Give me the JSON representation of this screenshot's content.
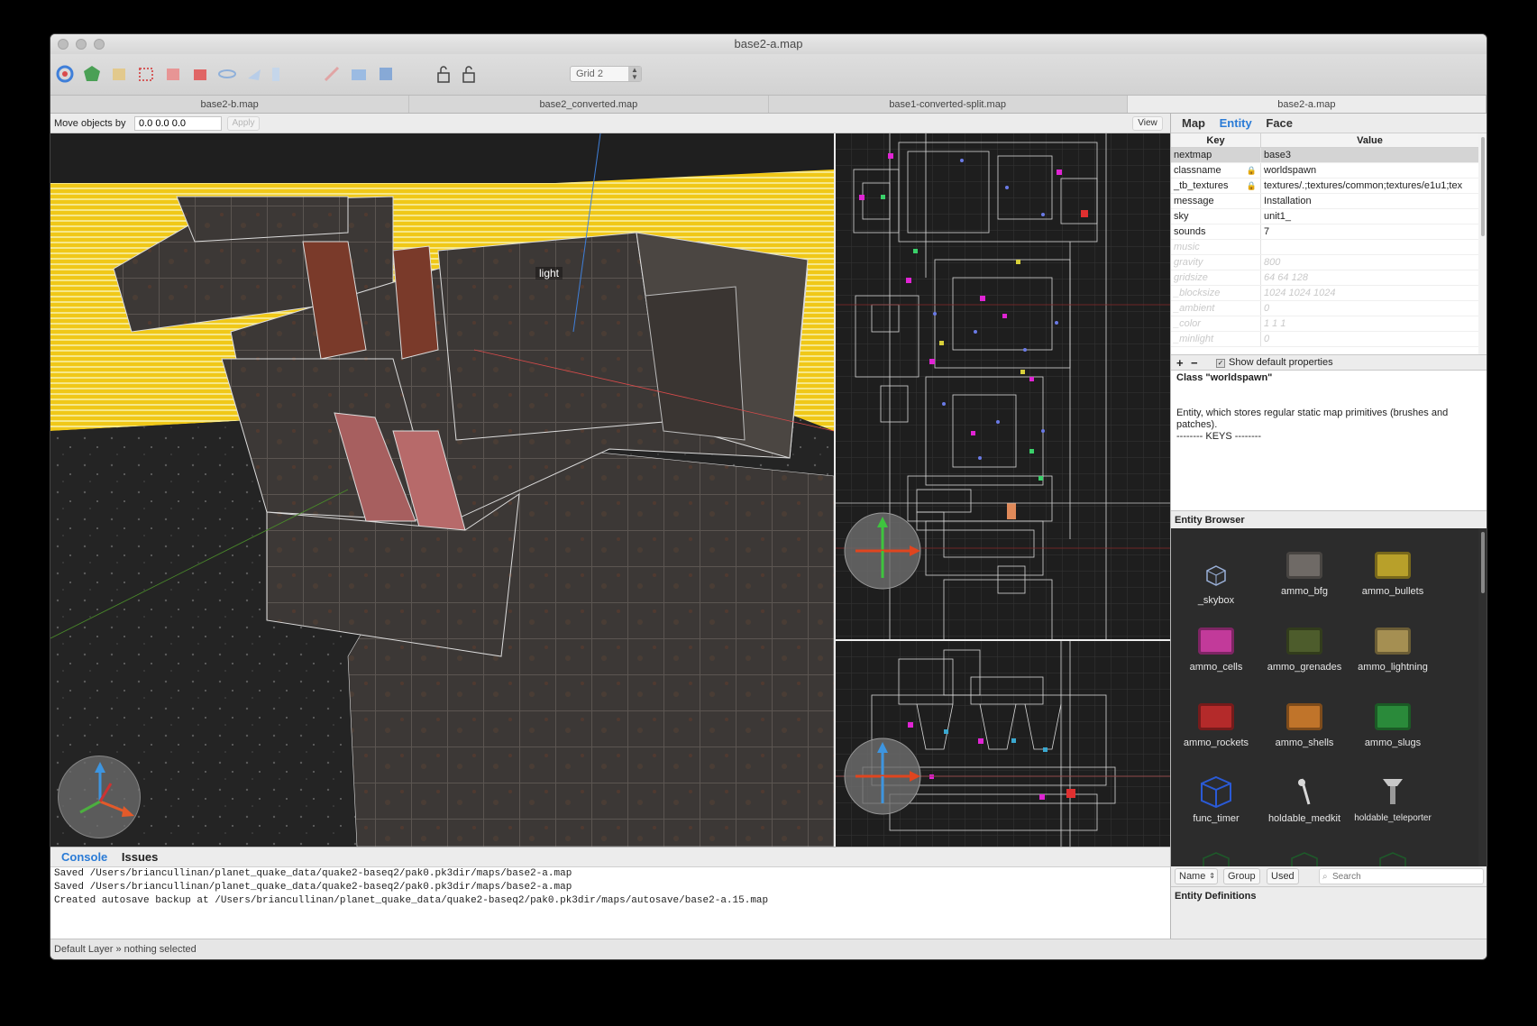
{
  "window": {
    "title": "base2-a.map"
  },
  "toolbar": {
    "grid_label": "Grid 2",
    "tool_icons": [
      "rotate-icon",
      "vertex-icon",
      "clip-icon",
      "brush-icon",
      "brush-red-icon",
      "brush-solid-icon",
      "flip-icon",
      "rotate-cw-icon",
      "trash-icon",
      "texture-lock-icon",
      "uv-icon",
      "shear-icon",
      "lock-icon",
      "lock-uv-icon"
    ]
  },
  "tabs": [
    "base2-b.map",
    "base2_converted.map",
    "base1-converted-split.map",
    "base2-a.map"
  ],
  "move": {
    "label": "Move objects by",
    "value": "0.0 0.0 0.0",
    "apply": "Apply",
    "view": "View"
  },
  "viewport": {
    "light_label": "light"
  },
  "console": {
    "tabs": [
      "Console",
      "Issues"
    ],
    "lines": [
      "Saved /Users/briancullinan/planet_quake_data/quake2-baseq2/pak0.pk3dir/maps/base2-a.map",
      "Saved /Users/briancullinan/planet_quake_data/quake2-baseq2/pak0.pk3dir/maps/base2-a.map",
      "Created autosave backup at /Users/briancullinan/planet_quake_data/quake2-baseq2/pak0.pk3dir/maps/autosave/base2-a.15.map"
    ]
  },
  "status": "Default Layer » nothing selected",
  "inspector": {
    "tabs": [
      "Map",
      "Entity",
      "Face"
    ],
    "active_tab": "Entity",
    "key_header": "Key",
    "value_header": "Value",
    "properties": [
      {
        "key": "nextmap",
        "value": "base3",
        "selected": true
      },
      {
        "key": "classname",
        "value": "worldspawn",
        "locked": true
      },
      {
        "key": "_tb_textures",
        "value": "textures/.;textures/common;textures/e1u1;tex",
        "locked": true
      },
      {
        "key": "message",
        "value": "Installation"
      },
      {
        "key": "sky",
        "value": "unit1_"
      },
      {
        "key": "sounds",
        "value": "7"
      },
      {
        "key": "music",
        "value": "",
        "dim": true
      },
      {
        "key": "gravity",
        "value": "800",
        "dim": true
      },
      {
        "key": "gridsize",
        "value": "64 64 128",
        "dim": true
      },
      {
        "key": "_blocksize",
        "value": "1024 1024 1024",
        "dim": true
      },
      {
        "key": "_ambient",
        "value": "0",
        "dim": true
      },
      {
        "key": "_color",
        "value": "1 1 1",
        "dim": true
      },
      {
        "key": "_minlight",
        "value": "0",
        "dim": true
      }
    ],
    "plus": "+",
    "minus": "−",
    "show_default": "Show default properties",
    "class_title": "Class \"worldspawn\"",
    "class_desc": "Entity, which stores regular static map primitives (brushes and patches).",
    "class_keys": "-------- KEYS --------",
    "entity_browser_title": "Entity Browser",
    "entities": [
      {
        "name": "_skybox",
        "color": "#3a3a3a",
        "icon": "cube-wireframe-icon"
      },
      {
        "name": "ammo_bfg",
        "color": "#6f6a66",
        "icon": "ammo-box-icon"
      },
      {
        "name": "ammo_bullets",
        "color": "#b8a02a",
        "icon": "ammo-box-icon"
      },
      {
        "name": "ammo_cells",
        "color": "#c23a9a",
        "icon": "ammo-box-icon"
      },
      {
        "name": "ammo_grenades",
        "color": "#4d5c2c",
        "icon": "ammo-box-icon"
      },
      {
        "name": "ammo_lightning",
        "color": "#a58f52",
        "icon": "ammo-box-icon"
      },
      {
        "name": "ammo_rockets",
        "color": "#b42a2a",
        "icon": "ammo-box-icon"
      },
      {
        "name": "ammo_shells",
        "color": "#c0742a",
        "icon": "ammo-box-icon"
      },
      {
        "name": "ammo_slugs",
        "color": "#2a8a3a",
        "icon": "ammo-box-icon"
      },
      {
        "name": "func_timer",
        "color": "#2a2a2a",
        "icon": "blue-cube-icon"
      },
      {
        "name": "holdable_medkit",
        "color": "#2a2a2a",
        "icon": "medkit-icon"
      },
      {
        "name": "holdable_teleporter",
        "color": "#2a2a2a",
        "icon": "teleporter-icon"
      }
    ],
    "sort": {
      "name": "Name",
      "group": "Group",
      "used": "Used",
      "search_placeholder": "Search"
    },
    "entity_definitions_title": "Entity Definitions"
  }
}
